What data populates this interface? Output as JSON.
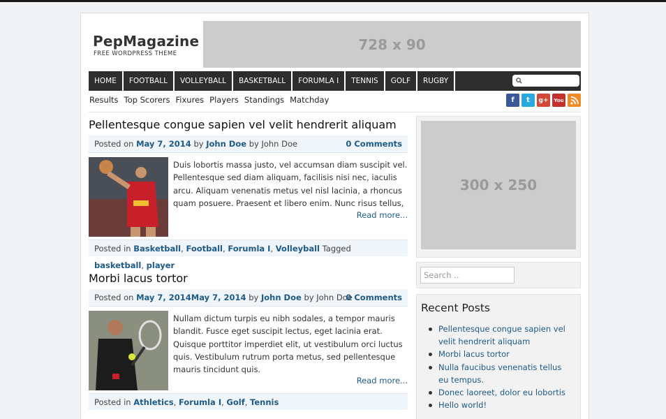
{
  "site": {
    "title": "PepMagazine",
    "tagline": "FREE WORDPRESS THEME",
    "banner_label": "728 x 90"
  },
  "nav": {
    "items": [
      "HOME",
      "FOOTBALL",
      "VOLLEYBALL",
      "BASKETBALL",
      "FORUMLA I",
      "TENNIS",
      "GOLF",
      "RUGBY"
    ]
  },
  "subnav": {
    "items": [
      "Results",
      "Top Scorers",
      "Fixures",
      "Players",
      "Standings",
      "Matchday"
    ]
  },
  "social": [
    "facebook-icon",
    "twitter-icon",
    "google-plus-icon",
    "youtube-icon",
    "rss-icon"
  ],
  "posts": [
    {
      "title": "Pellentesque congue sapien vel velit hendrerit aliquam",
      "posted_on": "Posted on",
      "date": "May 7, 2014",
      "by": "by",
      "author": "John Doe",
      "by2": "by John Doe",
      "comments": "0 Comments",
      "excerpt": "Duis lobortis massa justo, vel accumsan diam suscipit vel. Pellentesque sed diam aliquam, facilisis nisi nec, iaculis arcu. Aliquam venenatis metus vel nisl lacinia, a rhoncus quam posuere. Praesent et libero enim. Nunc risus tellus,",
      "read_more": "Read more...",
      "posted_in": "Posted in",
      "categories": [
        "Basketball",
        "Football",
        "Forumla I",
        "Volleyball"
      ],
      "tagged": "Tagged",
      "tags": [
        "basketball",
        "player"
      ]
    },
    {
      "title": "Morbi lacus tortor",
      "posted_on": "Posted on",
      "date": "May 7, 2014May 7, 2014",
      "by": "by",
      "author": "John Doe",
      "by2": "by John Doe",
      "comments": "0 Comments",
      "excerpt": "Nullam dictum turpis eu nibh sodales, a tempor mauris blandit. Fusce eget suscipit lectus, eget lacinia erat. Quisque porttitor imperdiet elit, ut vestibulum orci luctus quis. Vestibulum rutrum porta metus, sed pellentesque mauris tincidunt quis.",
      "read_more": "Read more...",
      "posted_in": "Posted in",
      "categories": [
        "Athletics",
        "Forumla I",
        "Golf",
        "Tennis"
      ]
    }
  ],
  "sidebar": {
    "ad_label": "300 x 250",
    "search_placeholder": "Search ..",
    "recent_title": "Recent Posts",
    "recent_posts": [
      "Pellentesque congue sapien vel velit hendrerit aliquam",
      "Morbi lacus tortor",
      "Nulla faucibus venenatis tellus eu tempus.",
      "Donec laoreet, dolor eu lobortis",
      "Hello world!"
    ]
  },
  "colors": {
    "link": "#1e5a8a",
    "nav_bg": "#2d2d2d",
    "meta_bg": "#f0f5f9",
    "ad_bg": "#cccccc"
  }
}
